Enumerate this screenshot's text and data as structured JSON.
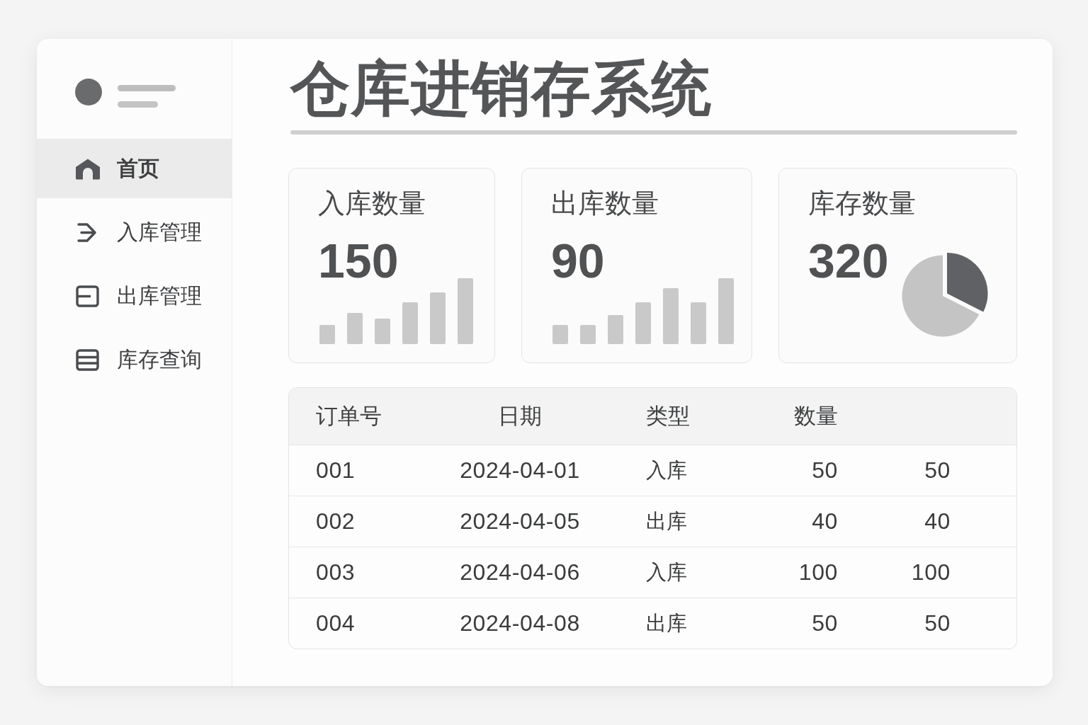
{
  "sidebar": {
    "items": [
      {
        "label": "首页",
        "selected": true
      },
      {
        "label": "入库管理",
        "selected": false
      },
      {
        "label": "出库管理",
        "selected": false
      },
      {
        "label": "库存查询",
        "selected": false
      }
    ]
  },
  "title": "仓库进销存系统",
  "stat_cards": [
    {
      "kind": "bars",
      "label": "入库数量",
      "value": "150"
    },
    {
      "kind": "bars",
      "label": "出库数量",
      "value": "90"
    },
    {
      "kind": "pie",
      "label": "库存数量",
      "value": "320"
    }
  ],
  "table": {
    "columns": [
      {
        "label": "订单号"
      },
      {
        "label": "日期"
      },
      {
        "label": "类型"
      },
      {
        "label": "数量"
      }
    ],
    "rows": [
      [
        "001",
        "2024-04-01",
        "入库",
        "50",
        "50"
      ],
      [
        "002",
        "2024-04-05",
        "出库",
        "40",
        "40"
      ],
      [
        "003",
        "2024-04-06",
        "入库",
        "100",
        "100"
      ],
      [
        "004",
        "2024-04-08",
        "出库",
        "50",
        "50"
      ]
    ]
  }
}
